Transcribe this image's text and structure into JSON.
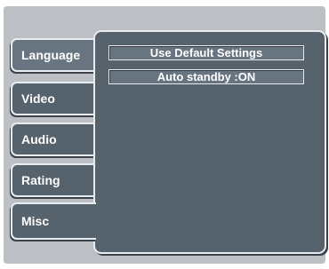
{
  "tabs": [
    {
      "label": "Language"
    },
    {
      "label": "Video"
    },
    {
      "label": "Audio"
    },
    {
      "label": "Rating"
    },
    {
      "label": "Misc"
    }
  ],
  "options": [
    {
      "label": "Use Default Settings"
    },
    {
      "label": "Auto standby :ON"
    }
  ],
  "active_tab": "Misc"
}
